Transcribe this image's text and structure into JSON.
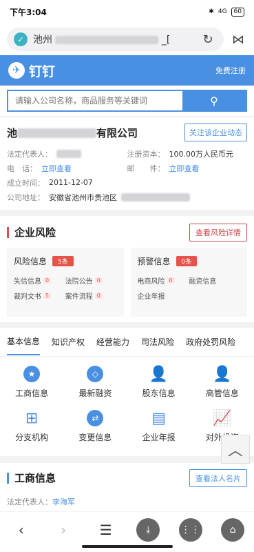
{
  "status": {
    "time": "下午3:04",
    "network": "4G",
    "battery": "60"
  },
  "url": {
    "prefix": "池州",
    "suffix": "_["
  },
  "brand": {
    "name": "钉钉",
    "register": "免费注册"
  },
  "search": {
    "placeholder": "请输入公司名称，商品服务等关键词"
  },
  "company": {
    "name_prefix": "池",
    "name_suffix": "有限公司",
    "follow": "关注该企业动态",
    "legal_label": "法定代表人：",
    "capital_label": "注册资本：",
    "capital_value": "100.00万人民币元",
    "phone_label": "电　话：",
    "phone_link": "立即查看",
    "mail_label": "邮　　件：",
    "mail_link": "立即查看",
    "founded_label": "成立时间：",
    "founded_value": "2011-12-07",
    "address_label": "公司地址：",
    "address_value": "安徽省池州市贵池区"
  },
  "risk": {
    "title": "企业风险",
    "detail_btn": "查看风险详情",
    "risk_info": {
      "label": "风险信息",
      "count": "5条",
      "items": [
        {
          "label": "失信信息",
          "count": "0"
        },
        {
          "label": "法院公告",
          "count": "0"
        },
        {
          "label": "裁判文书",
          "count": "5"
        },
        {
          "label": "案件流程",
          "count": "0"
        }
      ]
    },
    "warn_info": {
      "label": "预警信息",
      "count": "0条",
      "items": [
        {
          "label": "电商风险",
          "count": "0"
        },
        {
          "label": "融资信息",
          "count": ""
        },
        {
          "label": "企业年报",
          "count": ""
        }
      ]
    }
  },
  "tabs": [
    "基本信息",
    "知识产权",
    "经营能力",
    "司法风险",
    "政府处罚风险"
  ],
  "grid": [
    {
      "label": "工商信息",
      "icon": "police-badge-icon",
      "glyph": "★"
    },
    {
      "label": "最新融资",
      "icon": "diamond-icon",
      "glyph": "◇"
    },
    {
      "label": "股东信息",
      "icon": "shareholder-icon",
      "glyph": "👤"
    },
    {
      "label": "高管信息",
      "icon": "executive-icon",
      "glyph": "👤"
    },
    {
      "label": "分支机构",
      "icon": "org-tree-icon",
      "glyph": "⊞"
    },
    {
      "label": "变更信息",
      "icon": "swap-icon",
      "glyph": "⇄"
    },
    {
      "label": "企业年报",
      "icon": "report-icon",
      "glyph": "▤"
    },
    {
      "label": "对外投资",
      "icon": "trend-icon",
      "glyph": "📈"
    }
  ],
  "business": {
    "title": "工商信息",
    "btn": "查看法人名片",
    "legal_label": "法定代表人：",
    "legal_name": "李海军"
  },
  "colors": {
    "accent": "#4a90e2",
    "danger": "#e5534b"
  }
}
